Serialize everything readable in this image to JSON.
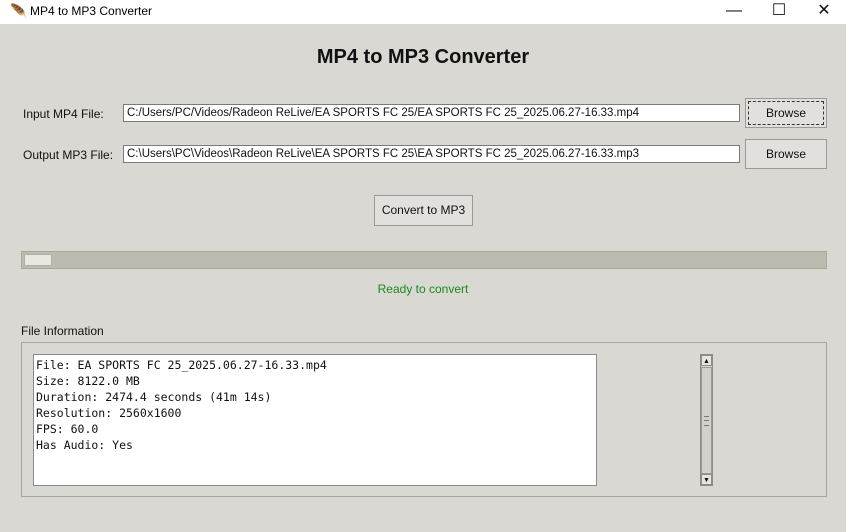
{
  "window": {
    "title": "MP4 to MP3 Converter",
    "icon": "feather-icon",
    "controls": {
      "minimize": "—",
      "maximize": "☐",
      "close": "✕"
    }
  },
  "header": {
    "title": "MP4 to MP3 Converter"
  },
  "input": {
    "label": "Input MP4 File:",
    "value": "C:/Users/PC/Videos/Radeon ReLive/EA SPORTS FC 25/EA SPORTS FC 25_2025.06.27-16.33.mp4",
    "browse_label": "Browse"
  },
  "output": {
    "label": "Output MP3 File:",
    "value": "C:\\Users\\PC\\Videos\\Radeon ReLive\\EA SPORTS FC 25\\EA SPORTS FC 25_2025.06.27-16.33.mp3",
    "browse_label": "Browse"
  },
  "convert": {
    "label": "Convert to MP3"
  },
  "progress": {
    "percent": 0
  },
  "status": {
    "text": "Ready to convert",
    "color": "#1a8a1a"
  },
  "file_info": {
    "label": "File Information",
    "lines": [
      "File: EA SPORTS FC 25_2025.06.27-16.33.mp4",
      "Size: 8122.0 MB",
      "Duration: 2474.4 seconds (41m 14s)",
      "Resolution: 2560x1600",
      "FPS: 60.0",
      "Has Audio: Yes"
    ]
  }
}
